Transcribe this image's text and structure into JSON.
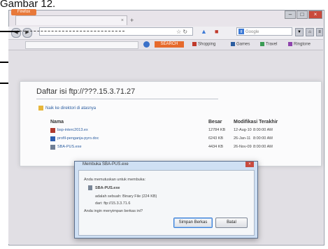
{
  "caption": "Gambar 12.",
  "browser": {
    "app_button": "Firefox",
    "tab_title": "",
    "tab_close": "×",
    "new_tab": "+",
    "nav": {
      "back": "◀",
      "forward": "▶"
    },
    "url_value": "",
    "search_placeholder": "Google",
    "bookmarks": {
      "search_button_label": "SEARCH",
      "items": [
        "Shopping",
        "Games",
        "Travel",
        "Ringtone"
      ]
    }
  },
  "page": {
    "title": "Daftar isi ftp://???.15.3.71.27",
    "parent_link": "Naik ke direktori di atasnya",
    "columns": {
      "name": "Nama",
      "size": "Besar",
      "modified": "Modifikasi Terakhir"
    },
    "files": [
      {
        "name": "bsp-interc2013.ex",
        "size": "12784 KB",
        "date": "12-Aug-10",
        "time": "8:00:00 AM",
        "color": "#b03a2e"
      },
      {
        "name": "profil-penganja-pyro.doc",
        "size": "6243 KB",
        "date": "26-Jan-11",
        "time": "8:00:00 AM",
        "color": "#2f5fb0"
      },
      {
        "name": "SBA-PUS.exe",
        "size": "4434 KB",
        "date": "26-Nov-09",
        "time": "8:00:00 AM",
        "color": "#6f7e95"
      }
    ]
  },
  "dialog": {
    "title": "Membuka SBA-PUS.exe",
    "close": "×",
    "intro": "Anda memutuskan untuk membuka:",
    "file_name": "SBA-PUS.exe",
    "type_line": "adalah sebuah: Binary File (224 KB)",
    "from_line": "dari: ftp://15.3.3.71.6",
    "question": "Anda ingin menyimpan berkas ini?",
    "save_button": "Simpan Berkas",
    "cancel_button": "Batal"
  }
}
